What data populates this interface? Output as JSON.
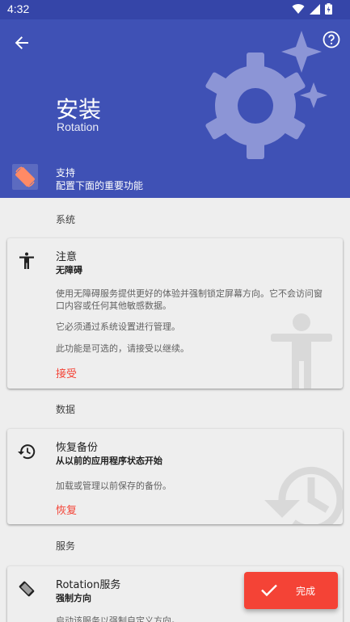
{
  "status_bar": {
    "time": "4:32"
  },
  "header": {
    "title": "安装",
    "subtitle": "Rotation",
    "support_title": "支持",
    "support_desc": "配置下面的重要功能"
  },
  "sections": {
    "system": "系统",
    "data": "数据",
    "service": "服务"
  },
  "accessibility_card": {
    "title": "注意",
    "subtitle": "无障碍",
    "text1": "使用无障碍服务提供更好的体验并强制锁定屏幕方向。它不会访问窗口内容或任何其他敏感数据。",
    "text2": "它必须通过系统设置进行管理。",
    "text3": "此功能是可选的，请接受以继续。",
    "action": "接受"
  },
  "restore_card": {
    "title": "恢复备份",
    "subtitle": "从以前的应用程序状态开始",
    "text1": "加载或管理以前保存的备份。",
    "action": "恢复"
  },
  "service_card": {
    "title": "Rotation服务",
    "subtitle": "强制方向",
    "text1": "启动该服务以强制自定义方向。"
  },
  "fab": {
    "label": "完成"
  },
  "colors": {
    "primary": "#3f51b5",
    "primary_dark": "#3545a8",
    "accent": "#f44336",
    "background": "#eeeeee"
  }
}
